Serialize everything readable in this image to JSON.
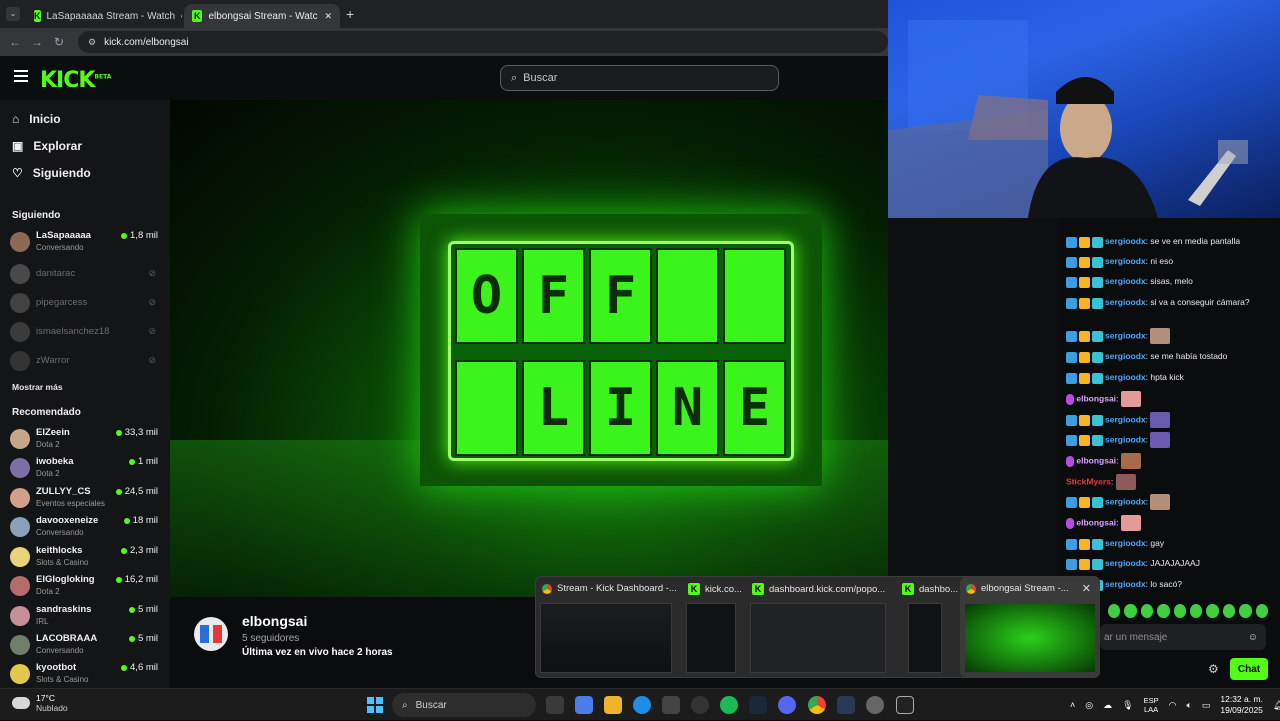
{
  "browser": {
    "tabs": [
      {
        "title": "LaSapaaaaa Stream - Watch"
      },
      {
        "title": "elbongsai Stream - Watch Live"
      }
    ],
    "new_tab": "+",
    "url": "kick.com/elbongsai"
  },
  "kick": {
    "logo": "KICK",
    "logo_badge": "BETA",
    "search_placeholder": "Buscar"
  },
  "sidebar": {
    "nav": [
      {
        "label": "Inicio",
        "icon": "home-icon"
      },
      {
        "label": "Explorar",
        "icon": "compass-icon"
      },
      {
        "label": "Siguiendo",
        "icon": "heart-icon"
      }
    ],
    "following_title": "Siguiendo",
    "following": [
      {
        "name": "LaSapaaaaa",
        "category": "Conversando",
        "viewers": "1,8 mil",
        "live": true
      },
      {
        "name": "danitarac",
        "live": false
      },
      {
        "name": "pipegarcess",
        "live": false
      },
      {
        "name": "ismaelsanchez18",
        "live": false
      },
      {
        "name": "zWarror",
        "live": false
      }
    ],
    "show_more": "Mostrar más",
    "recommended_title": "Recomendado",
    "recommended": [
      {
        "name": "ElZeein",
        "category": "Dota 2",
        "viewers": "33,3 mil"
      },
      {
        "name": "iwobeka",
        "category": "Dota 2",
        "viewers": "1 mil"
      },
      {
        "name": "ZULLYY_CS",
        "category": "Eventos especiales",
        "viewers": "24,5 mil"
      },
      {
        "name": "davooxeneize",
        "category": "Conversando",
        "viewers": "18 mil"
      },
      {
        "name": "keithlocks",
        "category": "Slots & Casino",
        "viewers": "2,3 mil"
      },
      {
        "name": "ElGlogloking",
        "category": "Dota 2",
        "viewers": "16,2 mil"
      },
      {
        "name": "sandraskins",
        "category": "IRL",
        "viewers": "5 mil"
      },
      {
        "name": "LACOBRAAA",
        "category": "Conversando",
        "viewers": "5 mil"
      },
      {
        "name": "kyootbot",
        "category": "Slots & Casino",
        "viewers": "4,6 mil"
      }
    ]
  },
  "player": {
    "sign_row1": [
      "O",
      "F",
      "F",
      "",
      ""
    ],
    "sign_row2": [
      "",
      "L",
      "I",
      "N",
      "E"
    ]
  },
  "channel": {
    "name": "elbongsai",
    "followers": "5 seguidores",
    "last_live": "Última vez en vivo hace 2 horas"
  },
  "chat": {
    "messages": [
      {
        "user": "sergioodx",
        "text": "se ve en media pantalla",
        "color": "#4aa8ff"
      },
      {
        "user": "sergioodx",
        "text": "ni eso",
        "color": "#4aa8ff"
      },
      {
        "user": "sergioodx",
        "text": "sisas, melo",
        "color": "#4aa8ff"
      },
      {
        "user": "sergioodx",
        "text": "si va a conseguir cámara?",
        "color": "#4aa8ff"
      },
      {
        "user": "sergioodx",
        "text": "",
        "color": "#4aa8ff"
      },
      {
        "user": "sergioodx",
        "text": "se me había tostado",
        "color": "#4aa8ff"
      },
      {
        "user": "sergioodx",
        "text": "hpta kick",
        "color": "#4aa8ff"
      },
      {
        "user": "elbongsai",
        "text": "",
        "color": "#d7a5ff"
      },
      {
        "user": "sergioodx",
        "text": "",
        "color": "#4aa8ff"
      },
      {
        "user": "sergioodx",
        "text": "",
        "color": "#4aa8ff"
      },
      {
        "user": "elbongsai",
        "text": "",
        "color": "#d7a5ff"
      },
      {
        "user": "StickMyers",
        "text": "",
        "color": "#e0393e"
      },
      {
        "user": "sergioodx",
        "text": "",
        "color": "#4aa8ff"
      },
      {
        "user": "elbongsai",
        "text": "",
        "color": "#d7a5ff"
      },
      {
        "user": "sergioodx",
        "text": "gay",
        "color": "#4aa8ff"
      },
      {
        "user": "sergioodx",
        "text": "JAJAJAJAAJ",
        "color": "#4aa8ff"
      },
      {
        "user": "sergioodx",
        "text": "lo sacó?",
        "color": "#4aa8ff"
      }
    ],
    "input_placeholder": "ar un mensaje",
    "send_label": "Chat"
  },
  "taskbar_preview": {
    "windows": [
      {
        "title": "Stream - Kick Dashboard -..."
      },
      {
        "title": "kick.co..."
      },
      {
        "title": "dashboard.kick.com/popo..."
      },
      {
        "title": "dashbo..."
      },
      {
        "title": "elbongsai Stream -..."
      }
    ],
    "close": "✕"
  },
  "taskbar": {
    "temperature": "17°C",
    "weather": "Nublado",
    "search_placeholder": "Buscar",
    "lang": "ESP",
    "lang2": "LAA",
    "time": "12:32 a. m.",
    "date": "19/09/2025"
  },
  "colors": {
    "kick_green": "#53fc18",
    "live_dot": "#53fc18"
  }
}
